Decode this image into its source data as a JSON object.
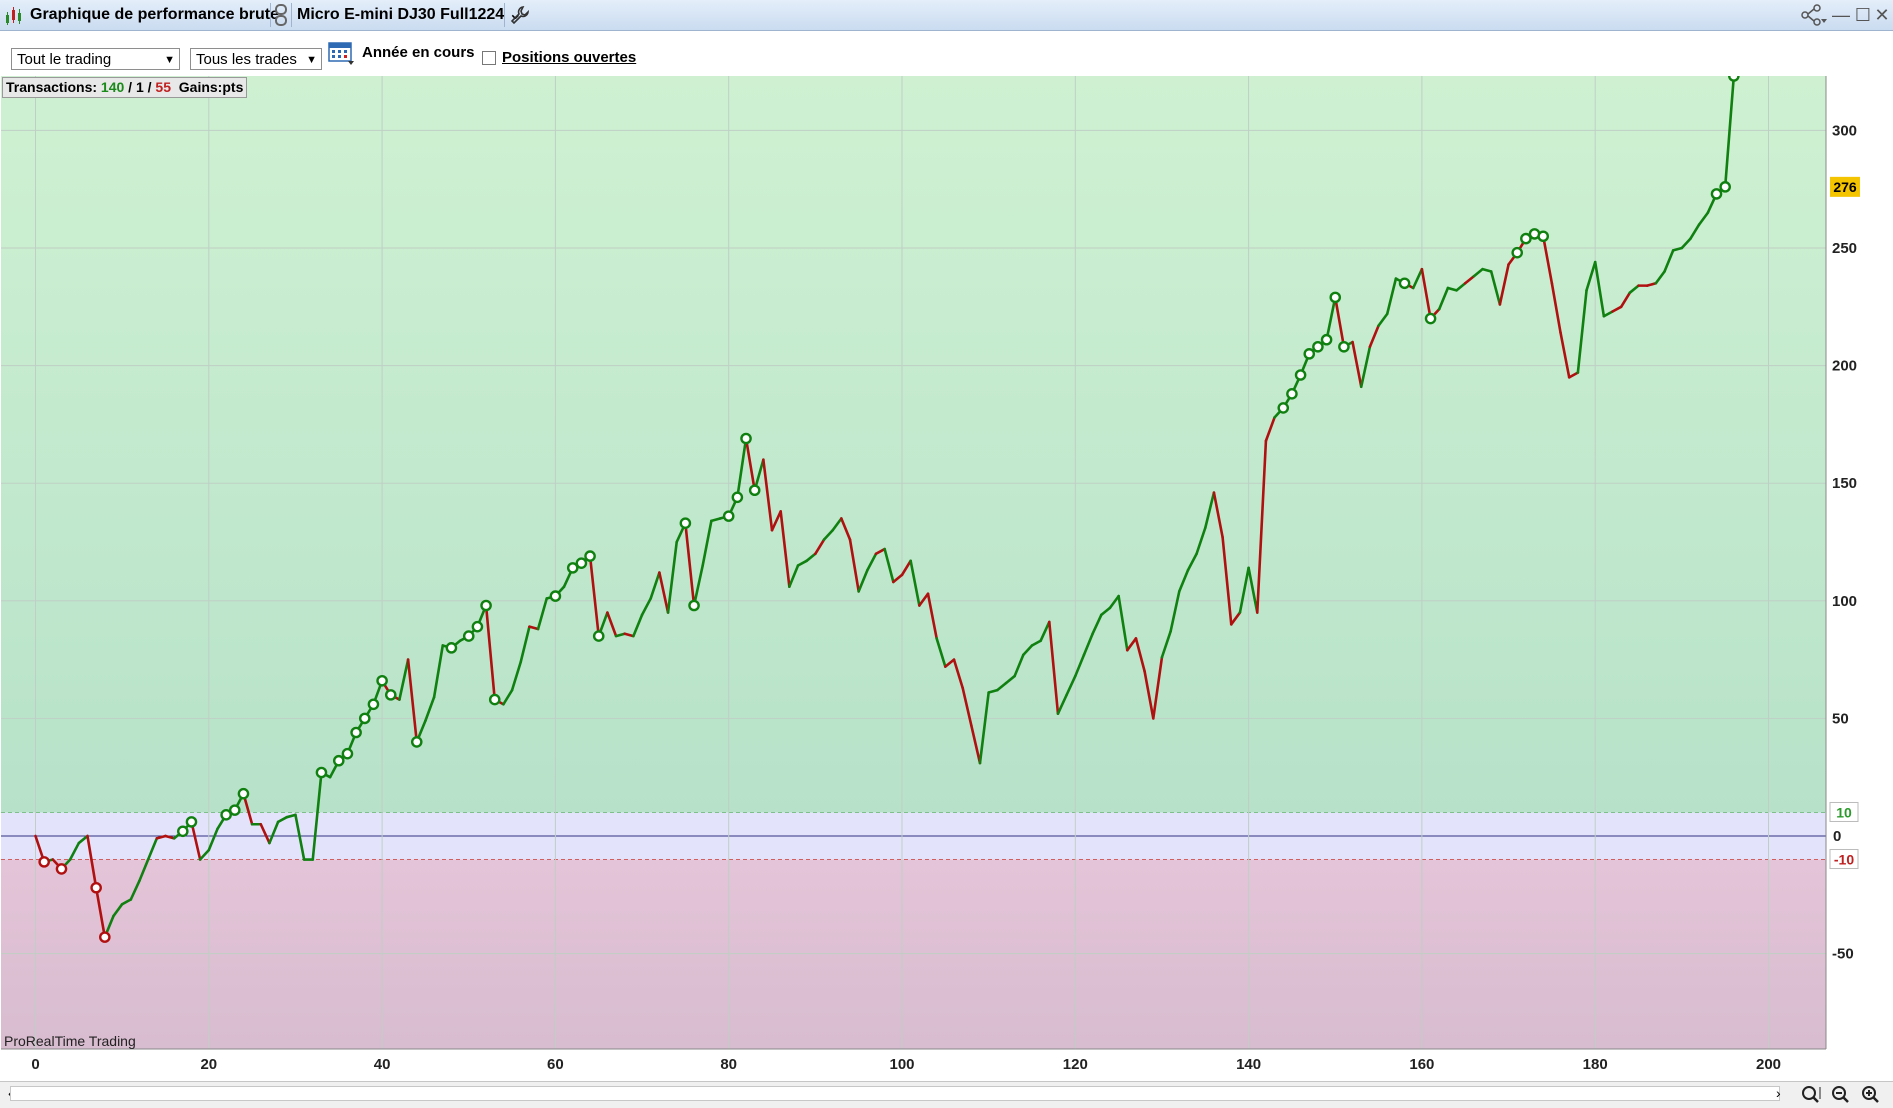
{
  "titlebar": {
    "title": "Graphique de performance brute",
    "instrument": "Micro E-mini DJ30 Full1224 ⌄",
    "icons": [
      "chart-icon",
      "link-icon",
      "wrench-icon",
      "share-icon",
      "minimize-icon",
      "maximize-icon",
      "close-icon"
    ]
  },
  "toolbar": {
    "scope_select": "Tout le trading",
    "trades_select": "Tous les trades",
    "period_label": "Année en cours",
    "open_positions_label": "Positions ouvertes",
    "open_positions_checked": false
  },
  "info": {
    "transactions_label": "Transactions:",
    "wins": "140",
    "sep1": "/",
    "neutral": "1",
    "sep2": "/",
    "losses": "55",
    "gains_label": "Gains:",
    "gains_unit": "pts"
  },
  "branding": "ProRealTime Trading",
  "colors": {
    "up": "#108010",
    "down": "#b01010",
    "last_value_badge": "#f5c400",
    "plus_band_label": "#2a9a2a",
    "minus_band_label": "#c02020"
  },
  "last_value_label": "276",
  "band_labels": {
    "plus": "10",
    "zero": "0",
    "minus": "-10"
  },
  "chart_data": {
    "type": "line",
    "title": "",
    "xlabel": "",
    "ylabel": "",
    "xlim": [
      -4,
      206
    ],
    "ylim": [
      -90,
      325
    ],
    "x_ticks": [
      0,
      20,
      40,
      60,
      80,
      100,
      120,
      140,
      160,
      180,
      200
    ],
    "y_ticks": [
      -50,
      50,
      100,
      150,
      200,
      250,
      300
    ],
    "grid": true,
    "band": [
      -10,
      10
    ],
    "x": [
      0,
      1,
      2,
      3,
      4,
      5,
      6,
      7,
      8,
      9,
      10,
      11,
      12,
      13,
      14,
      15,
      16,
      17,
      18,
      19,
      20,
      21,
      22,
      23,
      24,
      25,
      26,
      27,
      28,
      29,
      30,
      31,
      32,
      33,
      34,
      35,
      36,
      37,
      38,
      39,
      40,
      41,
      42,
      43,
      44,
      45,
      46,
      47,
      48,
      49,
      50,
      51,
      52,
      53,
      54,
      55,
      56,
      57,
      58,
      59,
      60,
      61,
      62,
      63,
      64,
      65,
      66,
      67,
      68,
      69,
      70,
      71,
      72,
      73,
      74,
      75,
      76,
      77,
      78,
      79,
      80,
      81,
      82,
      83,
      84,
      85,
      86,
      87,
      88,
      89,
      90,
      91,
      92,
      93,
      94,
      95,
      96,
      97,
      98,
      99,
      100,
      101,
      102,
      103,
      104,
      105,
      106,
      107,
      108,
      109,
      110,
      111,
      112,
      113,
      114,
      115,
      116,
      117,
      118,
      119,
      120,
      121,
      122,
      123,
      124,
      125,
      126,
      127,
      128,
      129,
      130,
      131,
      132,
      133,
      134,
      135,
      136,
      137,
      138,
      139,
      140,
      141,
      142,
      143,
      144,
      145,
      146,
      147,
      148,
      149,
      150,
      151,
      152,
      153,
      154,
      155,
      156,
      157,
      158,
      159,
      160,
      161,
      162,
      163,
      164,
      165,
      166,
      167,
      168,
      169,
      170,
      171,
      172,
      173,
      174,
      175,
      176,
      177,
      178,
      179,
      180,
      181,
      182,
      183,
      184,
      185,
      186,
      187,
      188,
      189,
      190,
      191,
      192,
      193,
      194,
      195,
      196
    ],
    "y": [
      0,
      -11,
      -10,
      -14,
      -10,
      -3,
      0,
      -22,
      -43,
      -34,
      -29,
      -27,
      -19,
      -10,
      -1,
      0,
      -1,
      2,
      6,
      -10,
      -6,
      3,
      9,
      11,
      18,
      5,
      5,
      -3,
      6,
      8,
      9,
      -10,
      -10,
      27,
      25,
      32,
      35,
      44,
      50,
      56,
      66,
      60,
      58,
      75,
      40,
      49,
      59,
      81,
      80,
      83,
      85,
      89,
      98,
      58,
      56,
      62,
      74,
      89,
      88,
      101,
      102,
      106,
      114,
      116,
      119,
      85,
      95,
      85,
      86,
      85,
      94,
      101,
      112,
      95,
      125,
      133,
      98,
      115,
      134,
      135,
      136,
      144,
      169,
      147,
      160,
      130,
      138,
      106,
      115,
      117,
      120,
      126,
      130,
      135,
      126,
      104,
      113,
      120,
      122,
      108,
      111,
      117,
      98,
      103,
      84,
      72,
      75,
      63,
      47,
      31,
      61,
      62,
      65,
      68,
      77,
      81,
      83,
      91,
      52,
      60,
      68,
      77,
      86,
      94,
      97,
      102,
      79,
      84,
      70,
      50,
      76,
      87,
      104,
      113,
      120,
      131,
      146,
      127,
      90,
      95,
      114,
      95,
      168,
      178,
      182,
      188,
      196,
      205,
      208,
      211,
      229,
      208,
      210,
      191,
      208,
      217,
      222,
      237,
      235,
      233,
      241,
      220,
      224,
      233,
      232,
      235,
      238,
      241,
      240,
      226,
      243,
      248,
      254,
      256,
      255,
      235,
      214,
      195,
      197,
      232,
      244,
      221,
      223,
      225,
      231,
      234,
      234,
      235,
      240,
      249,
      250,
      254,
      260,
      265,
      273,
      276
    ],
    "markers_high": [
      17,
      18,
      22,
      23,
      24,
      33,
      35,
      36,
      37,
      38,
      39,
      40,
      41,
      44,
      48,
      50,
      51,
      52,
      53,
      60,
      62,
      63,
      64,
      65,
      75,
      76,
      80,
      81,
      82,
      83,
      144,
      145,
      146,
      147,
      148,
      149,
      150,
      151,
      158,
      161,
      171,
      172,
      173,
      174,
      194,
      195,
      196,
      197
    ],
    "markers_low": [
      1,
      3,
      7,
      8
    ],
    "down_segments": [
      1,
      3,
      7,
      8,
      15,
      16,
      19,
      25,
      27,
      36,
      41,
      42,
      44,
      53,
      54,
      58,
      65,
      67,
      69,
      73,
      76,
      83,
      85,
      86,
      87,
      91,
      94,
      95,
      98,
      100,
      101,
      103,
      104,
      106,
      107,
      108,
      109,
      118,
      127,
      128,
      129,
      130,
      137,
      138,
      139,
      142,
      143,
      151,
      153,
      155,
      159,
      161,
      162,
      166,
      170,
      171,
      172,
      175,
      176,
      177,
      178,
      183,
      184,
      186,
      187
    ]
  }
}
